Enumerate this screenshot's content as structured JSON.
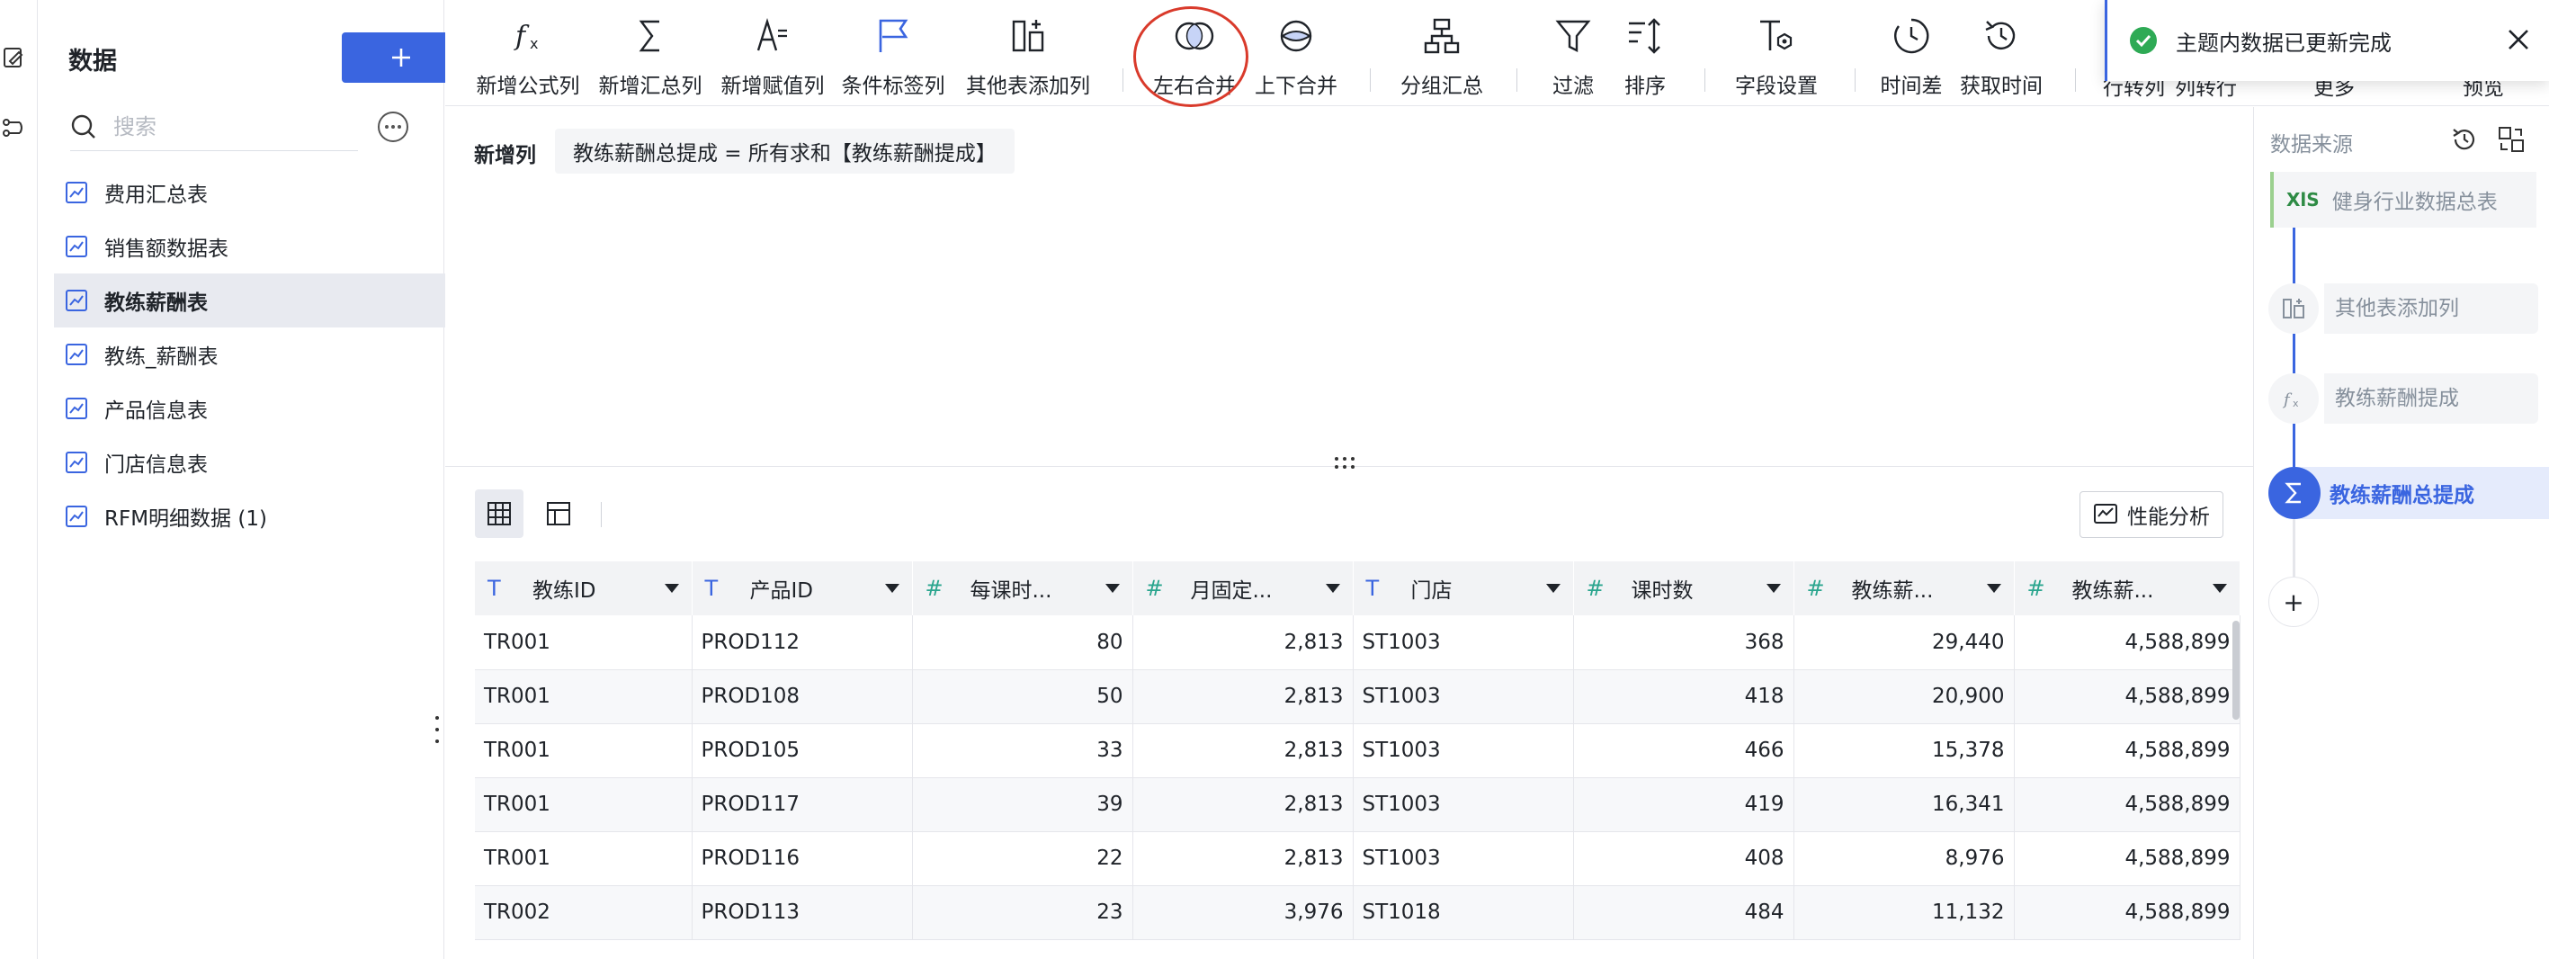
{
  "sidebar": {
    "title": "数据",
    "search_placeholder": "搜索",
    "items": [
      {
        "label": "费用汇总表"
      },
      {
        "label": "销售额数据表"
      },
      {
        "label": "教练薪酬表"
      },
      {
        "label": "教练_薪酬表"
      },
      {
        "label": "产品信息表"
      },
      {
        "label": "门店信息表"
      },
      {
        "label": "RFM明细数据 (1)"
      }
    ],
    "active_index": 2
  },
  "toolbar": {
    "buttons": [
      {
        "label": "新增公式列",
        "icon": "formula-icon"
      },
      {
        "label": "新增汇总列",
        "icon": "sigma-icon"
      },
      {
        "label": "新增赋值列",
        "icon": "assign-icon"
      },
      {
        "label": "条件标签列",
        "icon": "flag-icon"
      },
      {
        "label": "其他表添加列",
        "icon": "add-column-icon"
      },
      {
        "label": "左右合并",
        "icon": "venn-horizontal-icon"
      },
      {
        "label": "上下合并",
        "icon": "venn-vertical-icon"
      },
      {
        "label": "分组汇总",
        "icon": "group-icon"
      },
      {
        "label": "过滤",
        "icon": "filter-icon"
      },
      {
        "label": "排序",
        "icon": "sort-icon"
      },
      {
        "label": "字段设置",
        "icon": "field-settings-icon"
      },
      {
        "label": "时间差",
        "icon": "time-diff-icon"
      },
      {
        "label": "获取时间",
        "icon": "get-time-icon"
      }
    ],
    "cut_labels": [
      "行转列",
      "列转行",
      "更多",
      "预览"
    ]
  },
  "toast": {
    "message": "主题内数据已更新完成"
  },
  "formula": {
    "label": "新增列",
    "expression": "教练薪酬总提成 = 所有求和【教练薪酬提成】"
  },
  "table": {
    "perf_button": "性能分析",
    "columns": [
      {
        "name": "教练ID",
        "type": "text"
      },
      {
        "name": "产品ID",
        "type": "text"
      },
      {
        "name": "每课时...",
        "type": "number"
      },
      {
        "name": "月固定...",
        "type": "number"
      },
      {
        "name": "门店",
        "type": "text"
      },
      {
        "name": "课时数",
        "type": "number"
      },
      {
        "name": "教练薪...",
        "type": "number"
      },
      {
        "name": "教练薪...",
        "type": "number"
      }
    ],
    "rows": [
      [
        "TR001",
        "PROD112",
        "80",
        "2,813",
        "ST1003",
        "368",
        "29,440",
        "4,588,899"
      ],
      [
        "TR001",
        "PROD108",
        "50",
        "2,813",
        "ST1003",
        "418",
        "20,900",
        "4,588,899"
      ],
      [
        "TR001",
        "PROD105",
        "33",
        "2,813",
        "ST1003",
        "466",
        "15,378",
        "4,588,899"
      ],
      [
        "TR001",
        "PROD117",
        "39",
        "2,813",
        "ST1003",
        "419",
        "16,341",
        "4,588,899"
      ],
      [
        "TR001",
        "PROD116",
        "22",
        "2,813",
        "ST1003",
        "408",
        "8,976",
        "4,588,899"
      ],
      [
        "TR002",
        "PROD113",
        "23",
        "3,976",
        "ST1018",
        "484",
        "11,132",
        "4,588,899"
      ]
    ]
  },
  "right_panel": {
    "title": "数据来源",
    "source": {
      "badge": "XlS",
      "label": "健身行业数据总表"
    },
    "steps": [
      {
        "label": "其他表添加列",
        "icon": "add-column-icon"
      },
      {
        "label": "教练薪酬提成",
        "icon": "formula-icon"
      }
    ],
    "active_step": {
      "label": "教练薪酬总提成",
      "icon": "sigma-icon"
    },
    "add_symbol": "+"
  },
  "colors": {
    "accent": "#3a65e0",
    "annotation_circle": "#d93a2b",
    "success": "#2eaa55",
    "number_type": "#2aa58e"
  }
}
